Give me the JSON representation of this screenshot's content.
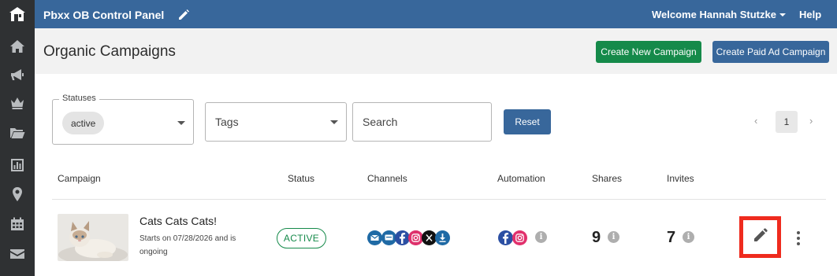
{
  "app": {
    "title": "Pbxx OB Control Panel",
    "welcome": "Welcome Hannah Stutzke",
    "help": "Help"
  },
  "sidebar": {
    "icons": [
      "logo-house-icon",
      "home-icon",
      "megaphone-icon",
      "crown-icon",
      "folder-icon",
      "bar-chart-icon",
      "location-pin-icon",
      "calendar-icon",
      "mail-icon"
    ]
  },
  "header": {
    "title": "Organic Campaigns",
    "create_new": "Create New Campaign",
    "create_paid": "Create Paid Ad Campaign"
  },
  "filters": {
    "statuses_label": "Statuses",
    "status_chip": "active",
    "tags_placeholder": "Tags",
    "search_placeholder": "Search",
    "reset": "Reset"
  },
  "pagination": {
    "prev": "‹",
    "current": "1",
    "next": "›"
  },
  "table": {
    "columns": [
      "Campaign",
      "Status",
      "Channels",
      "Automation",
      "Shares",
      "Invites"
    ],
    "rows": [
      {
        "name": "Cats Cats Cats!",
        "subtitle": "Starts on 07/28/2026 and is ongoing",
        "status": "ACTIVE",
        "channels": [
          "email",
          "sms",
          "facebook",
          "instagram",
          "x",
          "download"
        ],
        "automation": [
          "facebook",
          "instagram"
        ],
        "shares": "9",
        "invites": "7"
      }
    ]
  },
  "info_glyph": "i",
  "colors": {
    "topbar": "#38679b",
    "rail": "#2f3133",
    "green": "#158a4a",
    "highlight": "#ef2b1e"
  }
}
